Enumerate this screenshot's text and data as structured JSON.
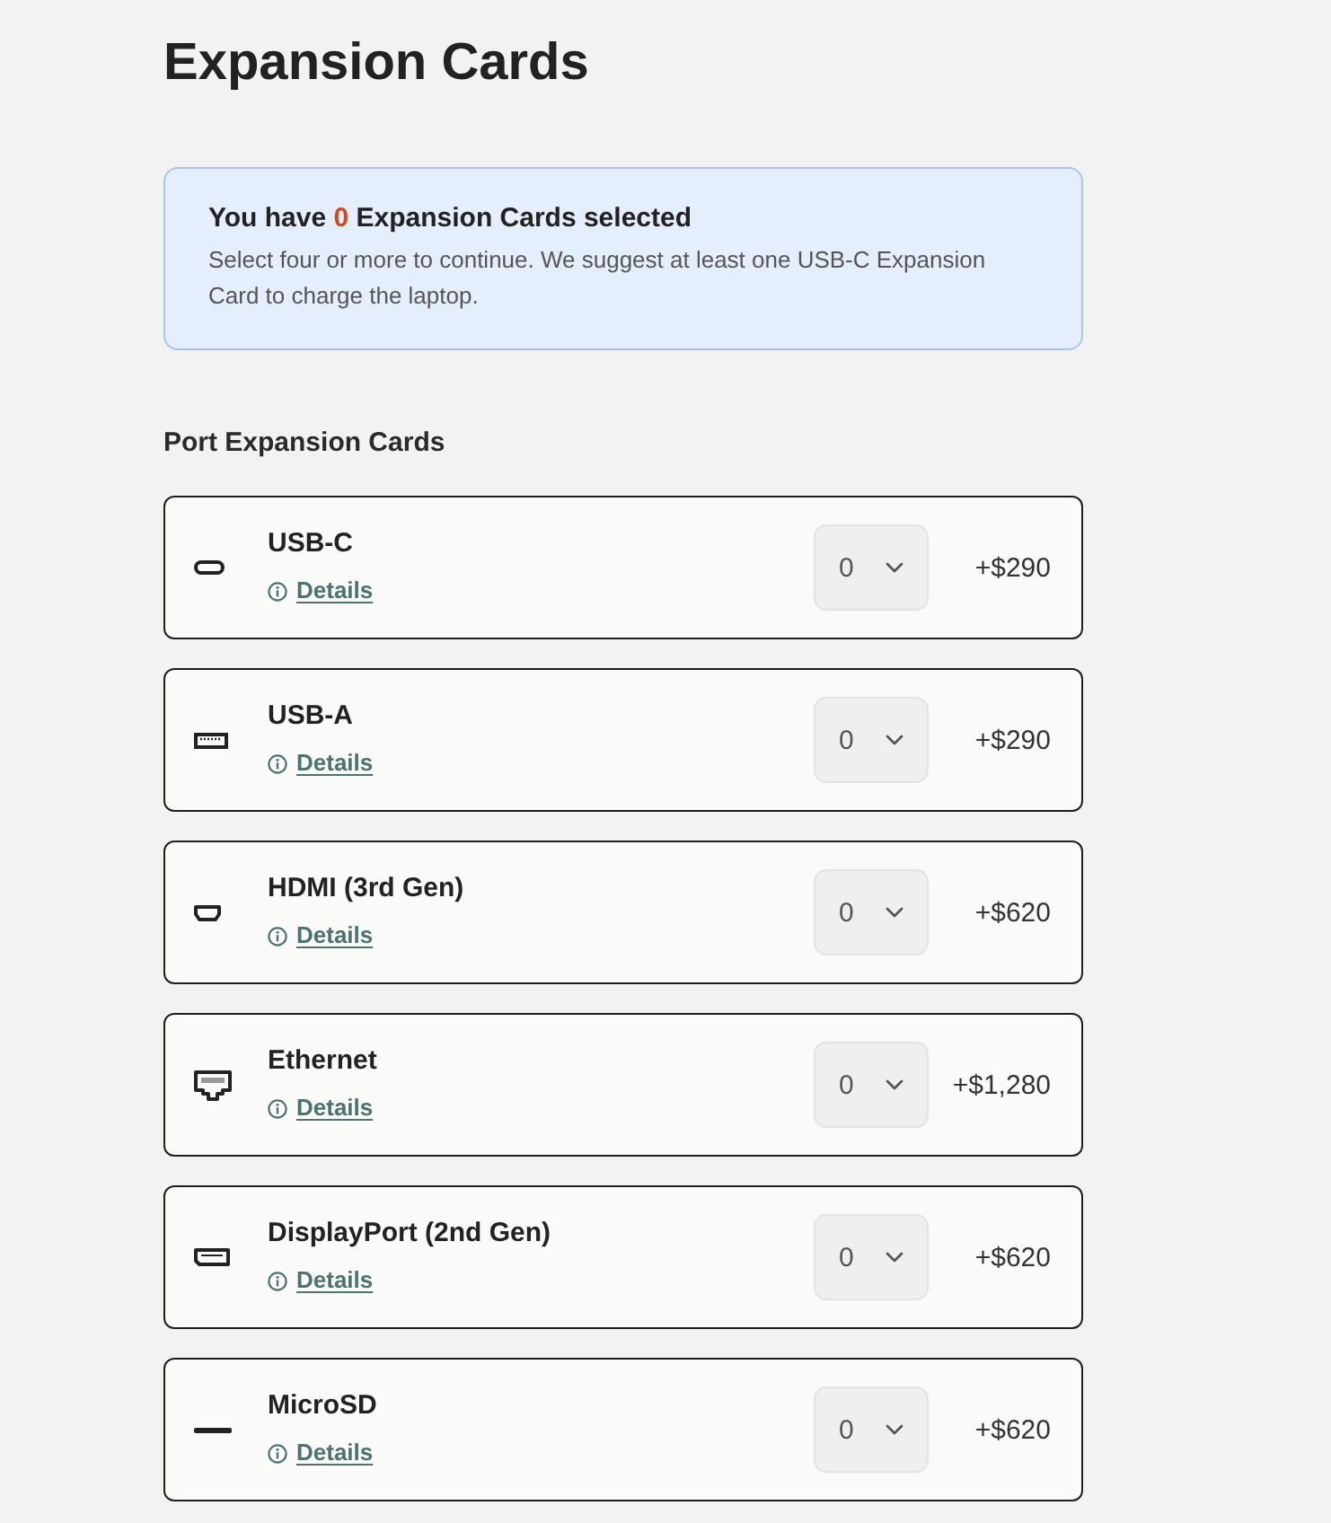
{
  "title": "Expansion Cards",
  "notice": {
    "heading_before": "You have",
    "count": "0",
    "heading_after": "Expansion Cards selected",
    "body": "Select four or more to continue. We suggest at least one USB-C Expansion Card to charge the laptop."
  },
  "section": {
    "heading": "Port Expansion Cards",
    "cards": [
      {
        "kind": "usb-c",
        "name": "USB-C",
        "link": "Details",
        "quantity": "0",
        "price": "+$290"
      },
      {
        "kind": "usb-a",
        "name": "USB-A",
        "link": "Details",
        "quantity": "0",
        "price": "+$290"
      },
      {
        "kind": "hdmi",
        "name": "HDMI (3rd Gen)",
        "link": "Details",
        "quantity": "0",
        "price": "+$620"
      },
      {
        "kind": "ethernet",
        "name": "Ethernet",
        "link": "Details",
        "quantity": "0",
        "price": "+$1,280"
      },
      {
        "kind": "displayport",
        "name": "DisplayPort (2nd Gen)",
        "link": "Details",
        "quantity": "0",
        "price": "+$620"
      },
      {
        "kind": "microsd",
        "name": "MicroSD",
        "link": "Details",
        "quantity": "0",
        "price": "+$620"
      }
    ]
  }
}
